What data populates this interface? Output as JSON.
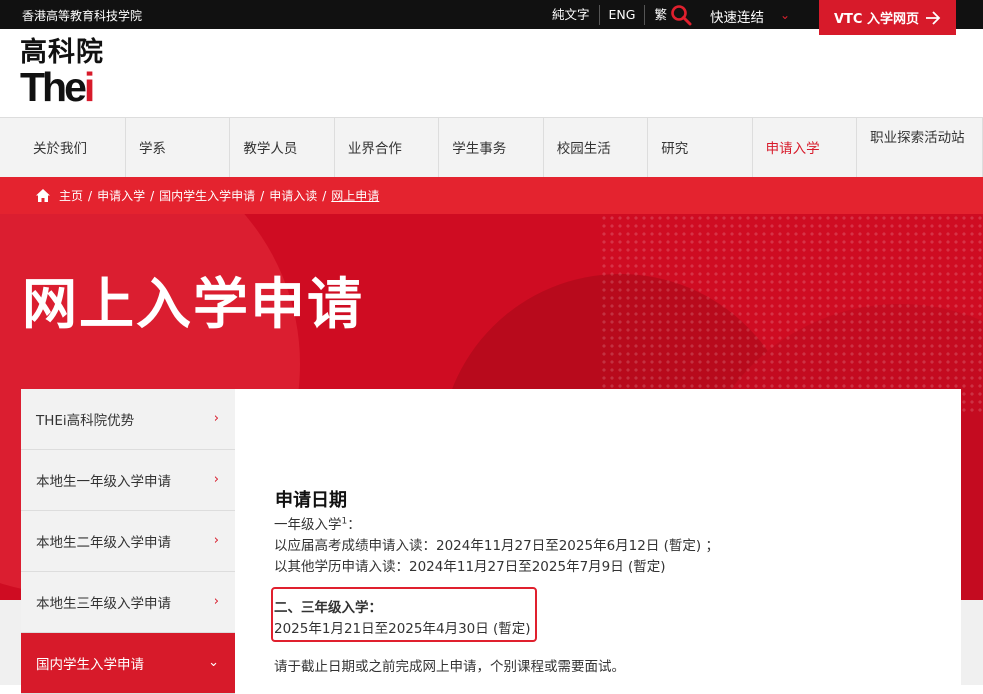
{
  "topbar": {
    "institution": "香港高等教育科技学院",
    "lang_plain": "純文字",
    "lang_eng": "ENG",
    "lang_trad": "繁",
    "quick_links": "快速连结",
    "vtc_button": "VTC 入学网页"
  },
  "logo": {
    "cn": "高科院",
    "en_the": "The",
    "en_i": "i"
  },
  "nav": [
    {
      "label": "关於我们"
    },
    {
      "label": "学系"
    },
    {
      "label": "教学人员"
    },
    {
      "label": "业界合作"
    },
    {
      "label": "学生事务"
    },
    {
      "label": "校园生活"
    },
    {
      "label": "研究"
    },
    {
      "label": "申请入学"
    },
    {
      "label": "职业探索活动站"
    }
  ],
  "breadcrumb": {
    "home": "主页",
    "c1": "申请入学",
    "c2": "国内学生入学申请",
    "c3": "申请入读",
    "current": "网上申请",
    "sep": "/"
  },
  "hero": {
    "title": "网上入学申请"
  },
  "sidebar": [
    {
      "label": "THEi高科院优势"
    },
    {
      "label": "本地生一年级入学申请"
    },
    {
      "label": "本地生二年级入学申请"
    },
    {
      "label": "本地生三年级入学申请"
    },
    {
      "label": "国内学生入学申请"
    }
  ],
  "content": {
    "heading": "申请日期",
    "year1_label": "一年级入学",
    "year1_sup": "1",
    "year1_colon": "：",
    "year1_line1": "以应届高考成绩申请入读：2024年11月27日至2025年6月12日 (暫定) ；",
    "year1_line2": "以其他学历申请入读：2024年11月27日至2025年7月9日 (暫定)",
    "year23_label": "二、三年级入学：",
    "year23_dates": "2025年1月21日至2025年4月30日 (暫定)",
    "note": "请于截止日期或之前完成网上申请，个别课程或需要面试。"
  },
  "colors": {
    "brand_red": "#d71a2a",
    "topbar_bg": "#111111"
  }
}
